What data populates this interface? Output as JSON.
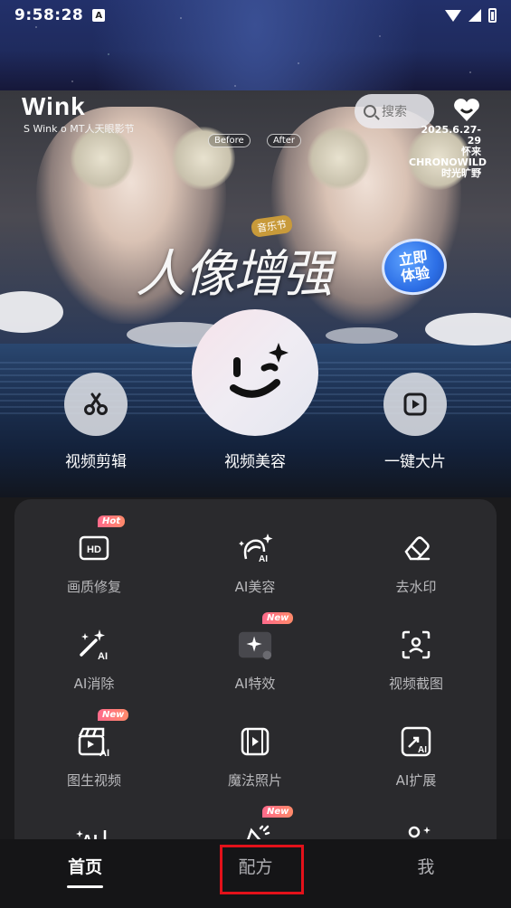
{
  "status_bar": {
    "time": "9:58:28",
    "notif_icon_letter": "A"
  },
  "banner": {
    "brand": "Wink",
    "brand_sub": "S Wink o  MT人天眼影节",
    "tag_before": "Before",
    "tag_after": "After",
    "search_placeholder": "搜索",
    "event_date": "2025.6.27-29",
    "event_city": "怀来",
    "event_name": "CHRONOWILD",
    "event_subname": "时光旷野",
    "music_tag": "音乐节",
    "headline": "人像增强",
    "try_line1": "立即",
    "try_line2": "体验"
  },
  "main_actions": [
    {
      "label": "视频剪辑",
      "icon": "scissors-icon"
    },
    {
      "label": "视频美容",
      "icon": "wink-face-icon"
    },
    {
      "label": "一键大片",
      "icon": "play-square-icon"
    }
  ],
  "features": [
    {
      "label": "画质修复",
      "icon": "hd-icon",
      "badge": "Hot"
    },
    {
      "label": "AI美容",
      "icon": "ai-face-icon",
      "badge": ""
    },
    {
      "label": "去水印",
      "icon": "eraser-icon",
      "badge": ""
    },
    {
      "label": "AI消除",
      "icon": "magic-wand-icon",
      "badge": ""
    },
    {
      "label": "AI特效",
      "icon": "sparkle-folder-icon",
      "badge": "New"
    },
    {
      "label": "视频截图",
      "icon": "screenshot-icon",
      "badge": ""
    },
    {
      "label": "图生视频",
      "icon": "clapper-ai-icon",
      "badge": "New"
    },
    {
      "label": "魔法照片",
      "icon": "film-play-icon",
      "badge": ""
    },
    {
      "label": "AI扩展",
      "icon": "expand-ai-icon",
      "badge": ""
    },
    {
      "label": "",
      "icon": "ai-text-icon",
      "badge": ""
    },
    {
      "label": "",
      "icon": "party-icon",
      "badge": "New"
    },
    {
      "label": "",
      "icon": "person-sparkle-icon",
      "badge": ""
    }
  ],
  "bottom_nav": [
    {
      "label": "首页",
      "active": true
    },
    {
      "label": "配方",
      "active": false
    },
    {
      "label": "我",
      "active": false
    }
  ],
  "colors": {
    "highlight_box": "#e3111a",
    "badge_gradient_start": "#ff6a8b",
    "try_badge_blue": "#2d6fe6"
  }
}
